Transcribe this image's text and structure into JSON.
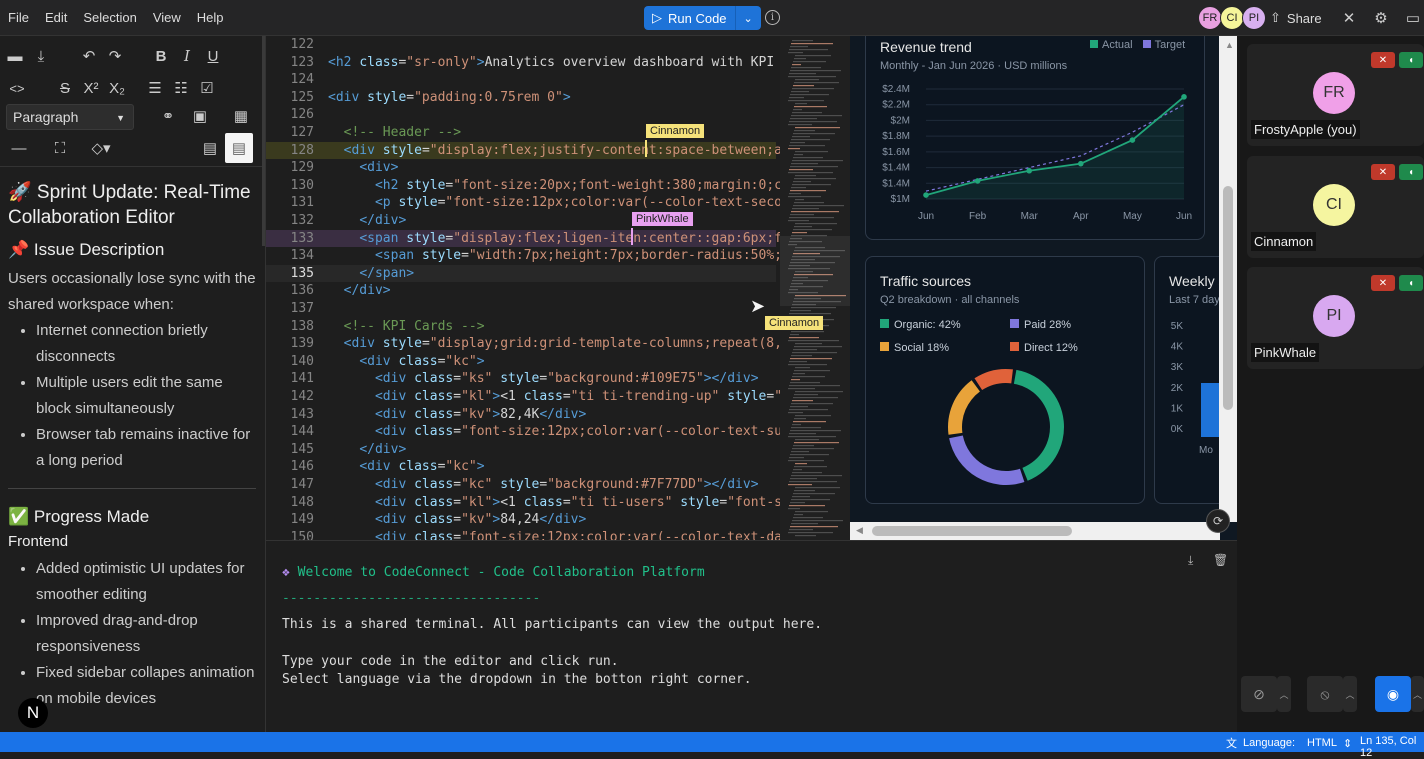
{
  "menu": [
    "File",
    "Edit",
    "Selection",
    "View",
    "Help"
  ],
  "toolbar": {
    "run_label": "Run Code",
    "share_label": "Share"
  },
  "avatars": [
    {
      "initials": "FR",
      "color": "#e8a0e0"
    },
    {
      "initials": "CI",
      "color": "#f5f59a"
    },
    {
      "initials": "PI",
      "color": "#d8b0f0"
    }
  ],
  "editor_panel": {
    "paragraph_select": "Paragraph",
    "doc": {
      "title": "🚀 Sprint Update: Real-Time Collaboration Editor",
      "issue_heading": "📌 Issue Description",
      "issue_text": "Users occasionally lose sync with the shared workspace when:",
      "issue_items": [
        "Internet connection brietly disconnects",
        "Multiple users edit the same block simultaneously",
        "Browser tab remains inactive for a long period"
      ],
      "progress_heading": "✅ Progress Made",
      "frontend_heading": "Frontend",
      "frontend_items": [
        "Added optimistic UI updates for smoother editing",
        "Improved drag-and-drop responsiveness",
        "Fixed sidebar collapes animation on mobile devices"
      ]
    },
    "badge": "N"
  },
  "code": {
    "current_line": "135",
    "lines": [
      {
        "n": "122",
        "html": ""
      },
      {
        "n": "123",
        "html": "<span class='tag'>&lt;h2</span> <span class='attr'>class</span>=<span class='str'>\"sr-only\"</span><span class='tag'>&gt;</span>Analytics overview dashboard with KPI c"
      },
      {
        "n": "124",
        "html": ""
      },
      {
        "n": "125",
        "html": "<span class='tag'>&lt;div</span> <span class='attr'>style</span>=<span class='str'>\"padding:0.75rem 0\"</span><span class='tag'>&gt;</span>"
      },
      {
        "n": "126",
        "html": ""
      },
      {
        "n": "127",
        "html": "  <span class='cmt'>&lt;!-- Header --&gt;</span>"
      },
      {
        "n": "128",
        "html": "  <span class='tag'>&lt;div</span> <span class='attr'>style</span>=<span class='str'>\"display:flex;justify-content:space-between;al</span>"
      },
      {
        "n": "129",
        "html": "    <span class='tag'>&lt;div&gt;</span>"
      },
      {
        "n": "130",
        "html": "      <span class='tag'>&lt;h2</span> <span class='attr'>style</span>=<span class='str'>\"font-size:20px;font-weight:380;margin:0;co</span>"
      },
      {
        "n": "131",
        "html": "      <span class='tag'>&lt;p</span> <span class='attr'>style</span>=<span class='str'>\"font-size:12px;color:var(--color-text-secon</span>"
      },
      {
        "n": "132",
        "html": "    <span class='tag'>&lt;/div&gt;</span>"
      },
      {
        "n": "133",
        "html": "    <span class='tag'>&lt;span</span> <span class='attr'>style</span>=<span class='str'>\"display:flex;ligen-iten:center::gap:6px;fo</span>"
      },
      {
        "n": "134",
        "html": "      <span class='tag'>&lt;span</span> <span class='attr'>style</span>=<span class='str'>\"width:7px;height:7px;border-radius:50%;b</span>"
      },
      {
        "n": "135",
        "html": "    <span class='tag'>&lt;/span&gt;</span>"
      },
      {
        "n": "136",
        "html": "  <span class='tag'>&lt;/div&gt;</span>"
      },
      {
        "n": "137",
        "html": ""
      },
      {
        "n": "138",
        "html": "  <span class='cmt'>&lt;!-- KPI Cards --&gt;</span>"
      },
      {
        "n": "139",
        "html": "  <span class='tag'>&lt;div</span> <span class='attr'>style</span>=<span class='str'>\"display;grid:grid-template-columns;repeat(8,1</span>"
      },
      {
        "n": "140",
        "html": "    <span class='tag'>&lt;div</span> <span class='attr'>class</span>=<span class='str'>\"kc\"</span><span class='tag'>&gt;</span>"
      },
      {
        "n": "141",
        "html": "      <span class='tag'>&lt;div</span> <span class='attr'>class</span>=<span class='str'>\"ks\"</span> <span class='attr'>style</span>=<span class='str'>\"background:#109E75\"</span><span class='tag'>&gt;&lt;/div&gt;</span>"
      },
      {
        "n": "142",
        "html": "      <span class='tag'>&lt;div</span> <span class='attr'>class</span>=<span class='str'>\"kl\"</span><span class='tag'>&gt;</span>&lt;1 <span class='attr'>class</span>=<span class='str'>\"ti ti-trending-up\"</span> <span class='attr'>style</span>=<span class='str'>\"f</span>"
      },
      {
        "n": "143",
        "html": "      <span class='tag'>&lt;div</span> <span class='attr'>class</span>=<span class='str'>\"kv\"</span><span class='tag'>&gt;</span>82,4K<span class='tag'>&lt;/div&gt;</span>"
      },
      {
        "n": "144",
        "html": "      <span class='tag'>&lt;div</span> <span class='attr'>class</span>=<span class='str'>\"font-size:12px;color:var(--color-text-suc</span>"
      },
      {
        "n": "145",
        "html": "    <span class='tag'>&lt;/div&gt;</span>"
      },
      {
        "n": "146",
        "html": "    <span class='tag'>&lt;div</span> <span class='attr'>class</span>=<span class='str'>\"kc\"</span><span class='tag'>&gt;</span>"
      },
      {
        "n": "147",
        "html": "      <span class='tag'>&lt;div</span> <span class='attr'>class</span>=<span class='str'>\"kc\"</span> <span class='attr'>style</span>=<span class='str'>\"background:#7F77DD\"</span><span class='tag'>&gt;&lt;/div&gt;</span>"
      },
      {
        "n": "148",
        "html": "      <span class='tag'>&lt;div</span> <span class='attr'>class</span>=<span class='str'>\"kl\"</span><span class='tag'>&gt;</span>&lt;1 <span class='attr'>class</span>=<span class='str'>\"ti ti-users\"</span> <span class='attr'>style</span>=<span class='str'>\"font-si</span>"
      },
      {
        "n": "149",
        "html": "      <span class='tag'>&lt;div</span> <span class='attr'>class</span>=<span class='str'>\"kv\"</span><span class='tag'>&gt;</span>84,24<span class='tag'>&lt;/div&gt;</span>"
      },
      {
        "n": "150",
        "html": "      <span class='tag'>&lt;div</span> <span class='attr'>class</span>=<span class='str'>\"font-size:12px;color:var(--color-text-dan</span>"
      }
    ],
    "cursor_flags": [
      {
        "label": "Cinnamon",
        "color": "#f5e27a"
      },
      {
        "label": "PinkWhale",
        "color": "#e8a0f0"
      },
      {
        "label": "Cinnamon",
        "color": "#f5e27a"
      }
    ]
  },
  "preview": {
    "revenue": {
      "title": "Revenue trend",
      "subtitle": "Monthly - Jan Jun 2026 · USD millions",
      "legend": [
        "Actual",
        "Target"
      ],
      "y_ticks": [
        "$2.4M",
        "$2.2M",
        "$2M",
        "$1.8M",
        "$1.6M",
        "$1.4M",
        "$1.4M",
        "$1M"
      ],
      "x_ticks": [
        "Jun",
        "Feb",
        "Mar",
        "Apr",
        "May",
        "Jun"
      ]
    },
    "traffic": {
      "title": "Traffic sources",
      "subtitle": "Q2 breakdown · all channels",
      "legend": [
        {
          "label": "Organic: 42%",
          "color": "#21a67a"
        },
        {
          "label": "Paid 28%",
          "color": "#7f77dd"
        },
        {
          "label": "Social 18%",
          "color": "#e8a33a"
        },
        {
          "label": "Direct 12%",
          "color": "#e0623a"
        }
      ]
    },
    "weekly": {
      "title": "Weekly s",
      "subtitle": "Last 7 day",
      "y_ticks": [
        "5K",
        "4K",
        "3K",
        "2K",
        "1K",
        "0K"
      ],
      "x_tick": "Mo"
    }
  },
  "chart_data": [
    {
      "type": "line",
      "title": "Revenue trend",
      "categories": [
        "Jun",
        "Feb",
        "Mar",
        "Apr",
        "May",
        "Jun"
      ],
      "series": [
        {
          "name": "Actual",
          "values": [
            1.05,
            1.23,
            1.36,
            1.45,
            1.75,
            2.3
          ]
        },
        {
          "name": "Target",
          "values": [
            1.1,
            1.25,
            1.4,
            1.55,
            1.85,
            2.2
          ]
        }
      ],
      "ylim": [
        1.0,
        2.4
      ],
      "colors": {
        "actual": "#21a67a",
        "target": "#7f77dd"
      }
    },
    {
      "type": "pie",
      "title": "Traffic sources",
      "categories": [
        "Organic",
        "Paid",
        "Social",
        "Direct"
      ],
      "values": [
        42,
        28,
        18,
        12
      ]
    }
  ],
  "videos": [
    {
      "initials": "FR",
      "name": "FrostyApple (you)",
      "color": "#f0a0e8"
    },
    {
      "initials": "CI",
      "name": "Cinnamon",
      "color": "#f5f5a0"
    },
    {
      "initials": "PI",
      "name": "PinkWhale",
      "color": "#d8a8f0"
    }
  ],
  "terminal": {
    "welcome": "Welcome to CodeConnect - Code Collaboration Platform",
    "divider": "---------------------------------",
    "line1": "This is a shared terminal. All participants can view the output here.",
    "line2": "Type your code in the editor and click run.",
    "line3": "Select language via the dropdown in the botton right corner."
  },
  "status": {
    "language_label": "Language:",
    "language": "HTML",
    "position": "Ln 135, Col 12"
  }
}
